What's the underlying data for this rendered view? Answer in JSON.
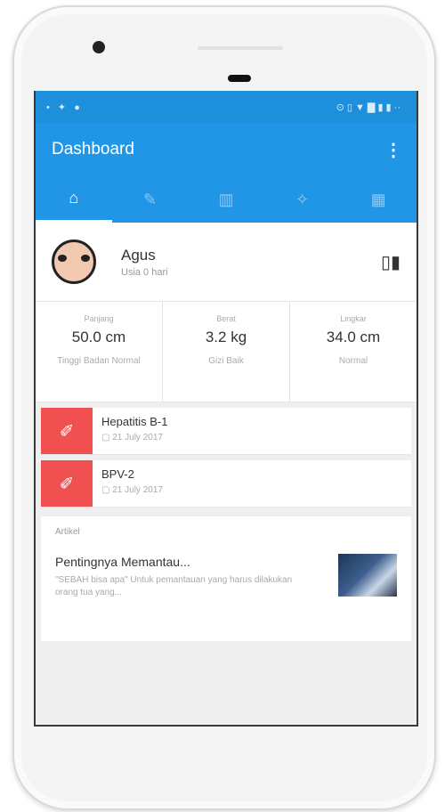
{
  "statusbar": {
    "left": [
      "•",
      "✦",
      "●"
    ],
    "right": "⊙ ▯ ▼ ▇ ▮ ▮ ··"
  },
  "appbar": {
    "title": "Dashboard",
    "menu_glyph": "⋮"
  },
  "tabs": [
    {
      "icon": "home-icon",
      "glyph": "⌂"
    },
    {
      "icon": "vaccine-icon",
      "glyph": "✎"
    },
    {
      "icon": "growth-chart-icon",
      "glyph": "▥"
    },
    {
      "icon": "tools-icon",
      "glyph": "✧"
    },
    {
      "icon": "calendar-icon",
      "glyph": "▦"
    }
  ],
  "profile": {
    "name": "Agus",
    "age": "Usia 0 hari",
    "qr_glyph": "▯▮"
  },
  "stats": [
    {
      "label": "Panjang",
      "value": "50.0 cm",
      "note": "Tinggi Badan Normal"
    },
    {
      "label": "Berat",
      "value": "3.2 kg",
      "note": "Gizi Baik"
    },
    {
      "label": "Lingkar",
      "value": "34.0 cm",
      "note": "Normal"
    }
  ],
  "vaccines": [
    {
      "name": "Hepatitis B-1",
      "date": "21 July 2017",
      "glyph": "✐"
    },
    {
      "name": "BPV-2",
      "date": "21 July 2017",
      "glyph": "✐"
    }
  ],
  "article": {
    "label": "Artikel",
    "title": "Pentingnya Memantau...",
    "body": "\"SEBAH bisa apa\" Untuk pemantauan yang harus dilakukan orang tua yang..."
  },
  "colors": {
    "primary": "#2196e6",
    "statusbar": "#1e8fdb",
    "vaccine": "#f05050"
  }
}
